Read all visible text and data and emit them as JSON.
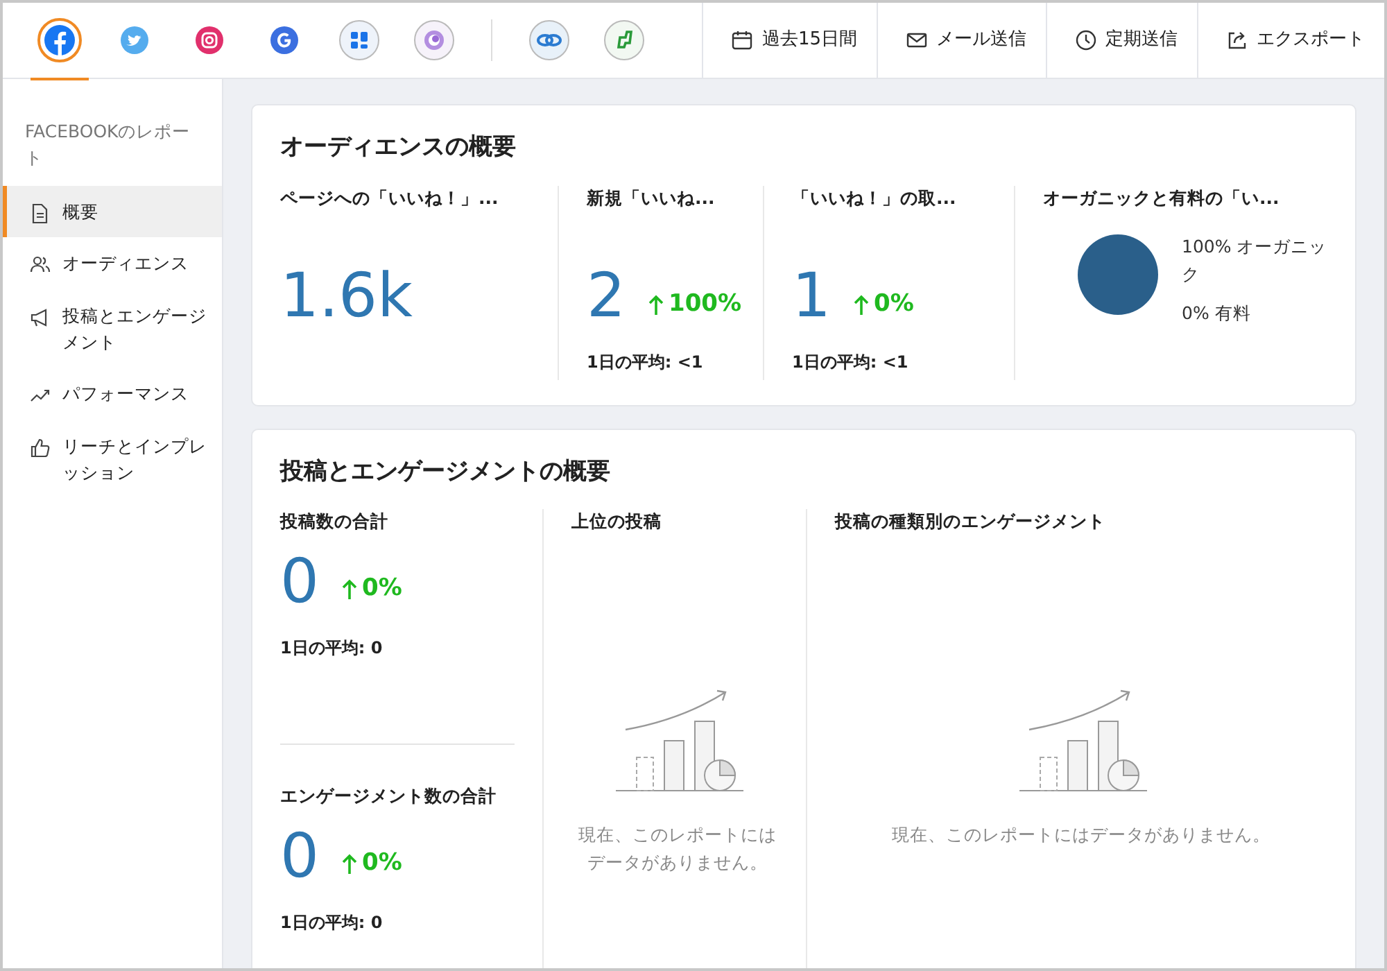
{
  "networks": [
    {
      "kind": "facebook",
      "selected": true
    },
    {
      "kind": "twitter",
      "selected": false
    },
    {
      "kind": "instagram",
      "selected": false
    },
    {
      "kind": "google",
      "selected": false
    },
    {
      "kind": "grid",
      "selected": false
    },
    {
      "kind": "ring",
      "selected": false
    },
    {
      "kind": "chain",
      "selected": false
    },
    {
      "kind": "leaf",
      "selected": false
    }
  ],
  "actions": [
    {
      "kind": "calendar",
      "label": "過去15日間"
    },
    {
      "kind": "mail",
      "label": "メール送信"
    },
    {
      "kind": "clock",
      "label": "定期送信"
    },
    {
      "kind": "export",
      "label": "エクスポート"
    }
  ],
  "sidebar": {
    "title": "FACEBOOKのレポート",
    "items": [
      {
        "kind": "doc",
        "label": "概要",
        "selected": true
      },
      {
        "kind": "people",
        "label": "オーディエンス",
        "selected": false
      },
      {
        "kind": "megaphone",
        "label": "投稿とエンゲージメント",
        "selected": false
      },
      {
        "kind": "trend",
        "label": "パフォーマンス",
        "selected": false
      },
      {
        "kind": "thumb",
        "label": "リーチとインプレッション",
        "selected": false
      }
    ]
  },
  "audience": {
    "title": "オーディエンスの概要",
    "metrics": [
      {
        "label": "ページへの「いいね！」...",
        "value": "1.6k"
      },
      {
        "label": "新規「いいね...",
        "value": "2",
        "change": "100%",
        "avg_label": "1日の平均:",
        "avg": "<1"
      },
      {
        "label": "「いいね！」の取...",
        "value": "1",
        "change": "0%",
        "avg_label": "1日の平均:",
        "avg": "<1"
      }
    ],
    "split": {
      "label": "オーガニックと有料の「い...",
      "chart_data": {
        "type": "pie",
        "categories": [
          "オーガニック",
          "有料"
        ],
        "series": [
          {
            "color": "#2a5f8a",
            "values": [
              100,
              0
            ]
          }
        ],
        "value_labels": [
          "100%",
          "0%"
        ]
      }
    }
  },
  "posts": {
    "title": "投稿とエンゲージメントの概要",
    "metrics": [
      {
        "label": "投稿数の合計",
        "value": "0",
        "change": "0%",
        "avg_label": "1日の平均:",
        "avg": "0"
      },
      {
        "label": "エンゲージメント数の合計",
        "value": "0",
        "change": "0%",
        "avg_label": "1日の平均:",
        "avg": "0"
      }
    ],
    "panels": [
      {
        "label": "上位の投稿",
        "empty": "現在、このレポートにはデータがありません。"
      },
      {
        "label": "投稿の種類別のエンゲージメント",
        "empty": "現在、このレポートにはデータがありません。"
      }
    ]
  }
}
